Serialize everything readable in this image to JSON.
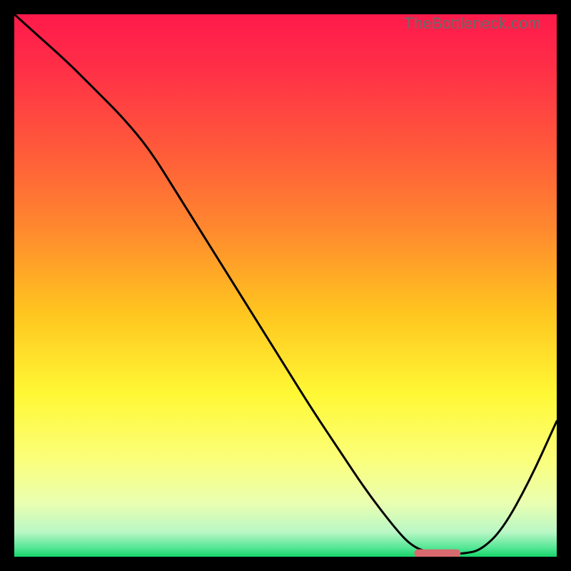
{
  "watermark": "TheBottleneck.com",
  "chart_data": {
    "type": "line",
    "title": "",
    "xlabel": "",
    "ylabel": "",
    "xlim": [
      0,
      100
    ],
    "ylim": [
      0,
      100
    ],
    "grid": false,
    "legend": false,
    "gradient_stops": [
      {
        "offset": 0.0,
        "color": "#ff1a4b"
      },
      {
        "offset": 0.1,
        "color": "#ff2f47"
      },
      {
        "offset": 0.25,
        "color": "#ff5a3a"
      },
      {
        "offset": 0.4,
        "color": "#ff8a2e"
      },
      {
        "offset": 0.55,
        "color": "#ffc51f"
      },
      {
        "offset": 0.7,
        "color": "#fff835"
      },
      {
        "offset": 0.82,
        "color": "#fbff7a"
      },
      {
        "offset": 0.9,
        "color": "#eaffb0"
      },
      {
        "offset": 0.955,
        "color": "#b9f7c5"
      },
      {
        "offset": 0.985,
        "color": "#4fe592"
      },
      {
        "offset": 1.0,
        "color": "#17d56a"
      }
    ],
    "series": [
      {
        "name": "bottleneck-curve",
        "x": [
          0,
          5,
          10,
          15,
          20,
          25,
          30,
          35,
          40,
          45,
          50,
          55,
          60,
          65,
          70,
          73,
          76,
          80,
          83,
          86,
          90,
          95,
          100
        ],
        "y": [
          100,
          95.5,
          91,
          86,
          81,
          75,
          67,
          59,
          51,
          43,
          35,
          27,
          19.5,
          12,
          5.5,
          2.2,
          0.8,
          0.5,
          0.6,
          1.2,
          5,
          14,
          25
        ]
      }
    ],
    "marker": {
      "name": "optimum-marker",
      "x_center": 78,
      "y": 0.7,
      "width": 8.5,
      "color": "#d86a6f"
    }
  }
}
